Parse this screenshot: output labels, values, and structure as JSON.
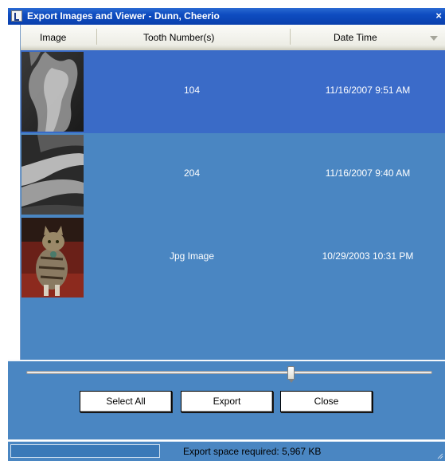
{
  "window": {
    "title": "Export Images and Viewer - Dunn, Cheerio",
    "close_glyph": "×"
  },
  "list": {
    "columns": [
      "Image",
      "Tooth Number(s)",
      "Date Time"
    ],
    "rows": [
      {
        "image": "xray-thumbnail",
        "tooth": "104",
        "datetime": "11/16/2007 9:51 AM",
        "selected": true
      },
      {
        "image": "xray-thumbnail",
        "tooth": "204",
        "datetime": "11/16/2007 9:40 AM",
        "selected": false
      },
      {
        "image": "cat-photo-thumbnail",
        "tooth": "Jpg Image",
        "datetime": "10/29/2003 10:31 PM",
        "selected": false
      }
    ]
  },
  "slider": {
    "level": 0.67
  },
  "buttons": {
    "select_all": "Select All",
    "export": "Export",
    "close": "Close"
  },
  "status": {
    "text": "Export space required: 5,967 KB",
    "progress": 0
  },
  "colors": {
    "titlebar": "#0e4cc0",
    "list_background": "#4a86c2",
    "selected_row": "#3a6bc7"
  }
}
